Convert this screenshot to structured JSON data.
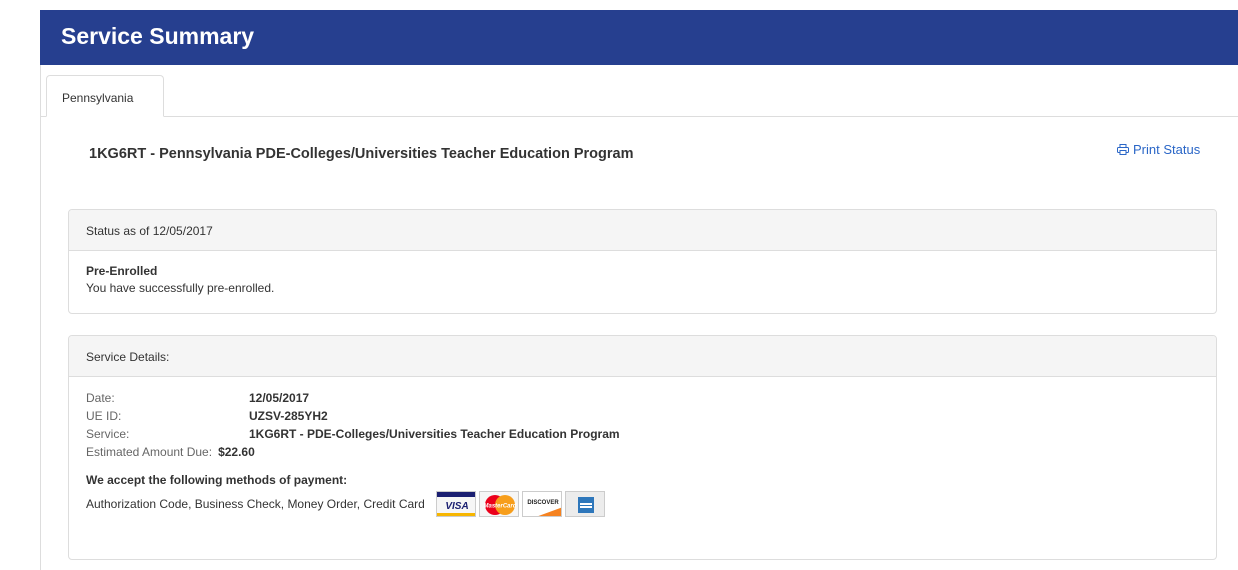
{
  "header": {
    "title": "Service Summary"
  },
  "tabs": [
    {
      "label": "Pennsylvania",
      "active": true
    }
  ],
  "service": {
    "title": "1KG6RT - Pennsylvania PDE-Colleges/Universities Teacher Education Program",
    "print_label": "Print Status"
  },
  "status_panel": {
    "heading": "Status as of 12/05/2017",
    "status": "Pre-Enrolled",
    "message": "You have successfully pre-enrolled."
  },
  "details_panel": {
    "heading": "Service Details:",
    "rows": [
      {
        "label": "Date:",
        "value": "12/05/2017"
      },
      {
        "label": "UE ID:",
        "value": "UZSV-285YH2"
      },
      {
        "label": "Service:",
        "value": "1KG6RT - PDE-Colleges/Universities Teacher Education Program"
      },
      {
        "label": "Estimated Amount Due:",
        "value": "$22.60"
      }
    ],
    "payment_heading": "We accept the following methods of payment:",
    "payment_methods": "Authorization Code, Business Check, Money Order, Credit Card",
    "cards": [
      {
        "icon": "visa-card-icon",
        "text": "VISA"
      },
      {
        "icon": "mastercard-icon",
        "text": "MasterCard"
      },
      {
        "icon": "discover-card-icon",
        "text": "DISCOVER"
      },
      {
        "icon": "amex-card-icon",
        "text": ""
      }
    ]
  },
  "colors": {
    "header_bg": "#263f8f",
    "link": "#2a66c7",
    "panel_heading_bg": "#f5f5f5",
    "border": "#dddddd"
  }
}
